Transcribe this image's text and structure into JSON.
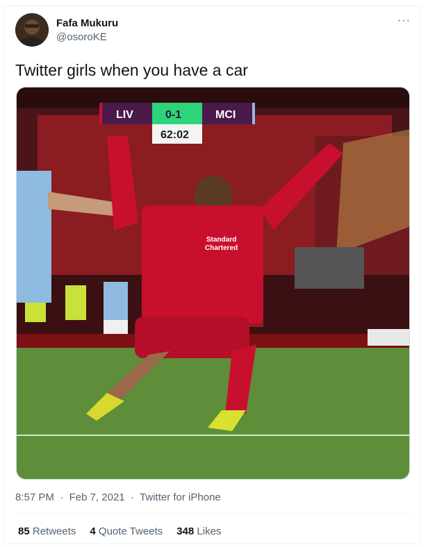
{
  "tweet": {
    "user": {
      "name": "Fafa Mukuru",
      "handle": "@osoroKE"
    },
    "more_icon": "···",
    "text": "Twitter girls when you have a car",
    "media": {
      "scoreboard": {
        "home": "LIV",
        "score": "0-1",
        "away": "MCI",
        "clock": "62:02"
      },
      "shirt_sponsor": [
        "Standard",
        "Chartered"
      ]
    },
    "timestamp": "8:57 PM",
    "date": "Feb 7, 2021",
    "source": "Twitter for iPhone",
    "sep": "·",
    "stats": {
      "retweets_count": "85",
      "retweets_label": "Retweets",
      "quotes_count": "4",
      "quotes_label": "Quote Tweets",
      "likes_count": "348",
      "likes_label": "Likes"
    }
  },
  "colors": {
    "liverpool_red": "#c8102e",
    "city_blue": "#8fbbe0",
    "pitch_green": "#5e8e3a",
    "score_green": "#2ed47a"
  }
}
